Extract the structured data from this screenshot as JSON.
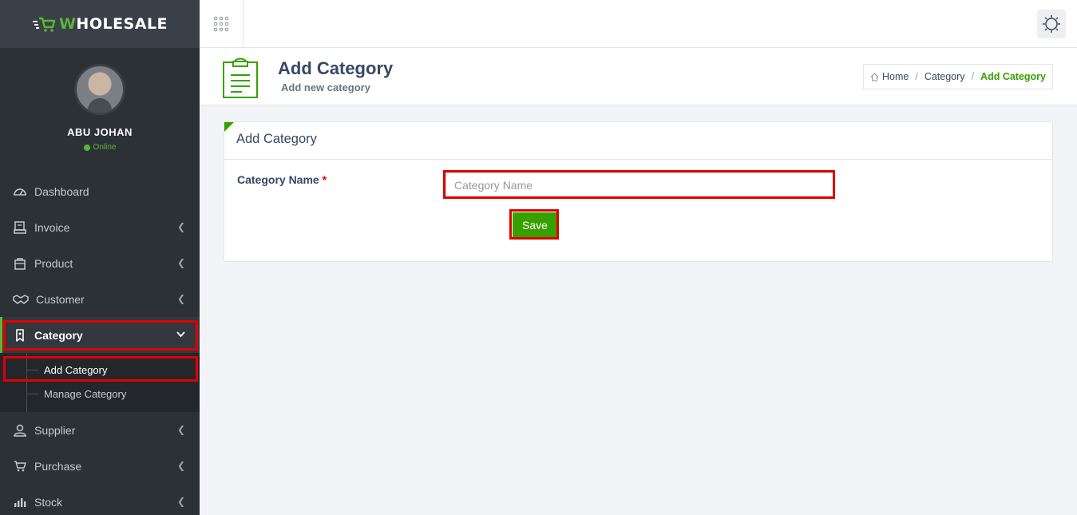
{
  "brand": {
    "logo_prefix": "W",
    "logo_rest": "HOLESALE"
  },
  "user": {
    "name": "ABU JOHAN",
    "status": "Online"
  },
  "sidebar": {
    "items": [
      {
        "label": "Dashboard",
        "icon": "dashboard-gauge-icon"
      },
      {
        "label": "Invoice",
        "icon": "invoice-icon"
      },
      {
        "label": "Product",
        "icon": "product-box-icon"
      },
      {
        "label": "Customer",
        "icon": "handshake-icon"
      },
      {
        "label": "Category",
        "icon": "bookmark-tag-icon"
      },
      {
        "label": "Supplier",
        "icon": "user-icon"
      },
      {
        "label": "Purchase",
        "icon": "cart-icon"
      },
      {
        "label": "Stock",
        "icon": "bar-chart-icon"
      }
    ],
    "category_sub": [
      {
        "label": "Add Category"
      },
      {
        "label": "Manage Category"
      }
    ]
  },
  "header": {
    "title": "Add Category",
    "subtitle": "Add new category",
    "breadcrumb": {
      "home": "Home",
      "mid": "Category",
      "current": "Add Category"
    }
  },
  "panel": {
    "title": "Add Category",
    "field_label": "Category Name",
    "required_mark": "*",
    "input_value": "",
    "input_placeholder": "Category Name",
    "save_label": "Save"
  },
  "colors": {
    "accent": "#37a000",
    "sidebar_bg": "#2c3136",
    "highlight": "#e00000"
  }
}
